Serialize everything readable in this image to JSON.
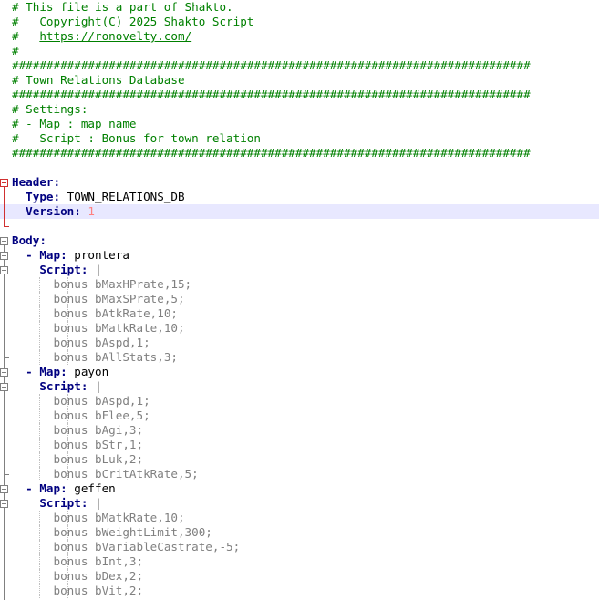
{
  "lines": [
    {
      "t": "comment",
      "text": "# This file is a part of Shakto."
    },
    {
      "t": "comment",
      "text": "#   Copyright(C) 2025 Shakto Script"
    },
    {
      "t": "link",
      "prefix": "#   ",
      "text": "https://ronovelty.com/"
    },
    {
      "t": "comment",
      "text": "#"
    },
    {
      "t": "comment",
      "text": "###########################################################################"
    },
    {
      "t": "comment",
      "text": "# Town Relations Database"
    },
    {
      "t": "comment",
      "text": "###########################################################################"
    },
    {
      "t": "comment",
      "text": "# Settings:"
    },
    {
      "t": "comment",
      "text": "# - Map : map name"
    },
    {
      "t": "comment",
      "text": "#   Script : Bonus for town relation"
    },
    {
      "t": "comment",
      "text": "###########################################################################"
    },
    {
      "t": "blank",
      "text": ""
    },
    {
      "t": "key",
      "indent": "",
      "key": "Header:",
      "val": ""
    },
    {
      "t": "key",
      "indent": "  ",
      "key": "Type:",
      "val": " TOWN_RELATIONS_DB"
    },
    {
      "t": "keynum",
      "indent": "  ",
      "key": "Version:",
      "val": " 1"
    },
    {
      "t": "blank",
      "text": ""
    },
    {
      "t": "key",
      "indent": "",
      "key": "Body:",
      "val": ""
    },
    {
      "t": "map",
      "indent": "  ",
      "dash": "- ",
      "key": "Map:",
      "val": " prontera"
    },
    {
      "t": "script",
      "indent": "    ",
      "key": "Script:",
      "val": " |"
    },
    {
      "t": "bonus",
      "indent": "      ",
      "text": "bonus bMaxHPrate,15;"
    },
    {
      "t": "bonus",
      "indent": "      ",
      "text": "bonus bMaxSPrate,5;"
    },
    {
      "t": "bonus",
      "indent": "      ",
      "text": "bonus bAtkRate,10;"
    },
    {
      "t": "bonus",
      "indent": "      ",
      "text": "bonus bMatkRate,10;"
    },
    {
      "t": "bonus",
      "indent": "      ",
      "text": "bonus bAspd,1;"
    },
    {
      "t": "bonus",
      "indent": "      ",
      "text": "bonus bAllStats,3;"
    },
    {
      "t": "map",
      "indent": "  ",
      "dash": "- ",
      "key": "Map:",
      "val": " payon"
    },
    {
      "t": "script",
      "indent": "    ",
      "key": "Script:",
      "val": " |"
    },
    {
      "t": "bonus",
      "indent": "      ",
      "text": "bonus bAspd,1;"
    },
    {
      "t": "bonus",
      "indent": "      ",
      "text": "bonus bFlee,5;"
    },
    {
      "t": "bonus",
      "indent": "      ",
      "text": "bonus bAgi,3;"
    },
    {
      "t": "bonus",
      "indent": "      ",
      "text": "bonus bStr,1;"
    },
    {
      "t": "bonus",
      "indent": "      ",
      "text": "bonus bLuk,2;"
    },
    {
      "t": "bonus",
      "indent": "      ",
      "text": "bonus bCritAtkRate,5;"
    },
    {
      "t": "map",
      "indent": "  ",
      "dash": "- ",
      "key": "Map:",
      "val": " geffen"
    },
    {
      "t": "script",
      "indent": "    ",
      "key": "Script:",
      "val": " |"
    },
    {
      "t": "bonus",
      "indent": "      ",
      "text": "bonus bMatkRate,10;"
    },
    {
      "t": "bonus",
      "indent": "      ",
      "text": "bonus bWeightLimit,300;"
    },
    {
      "t": "bonus",
      "indent": "      ",
      "text": "bonus bVariableCastrate,-5;"
    },
    {
      "t": "bonus",
      "indent": "      ",
      "text": "bonus bInt,3;"
    },
    {
      "t": "bonus",
      "indent": "      ",
      "text": "bonus bDex,2;"
    },
    {
      "t": "bonus",
      "indent": "      ",
      "text": "bonus bVit,2;"
    }
  ],
  "current_line": 14,
  "colors": {
    "comment": "#008000",
    "key": "#000080",
    "number": "#ff8080",
    "bonus": "#808080",
    "current_line": "#e8e8ff",
    "fold_active": "#d03030"
  }
}
